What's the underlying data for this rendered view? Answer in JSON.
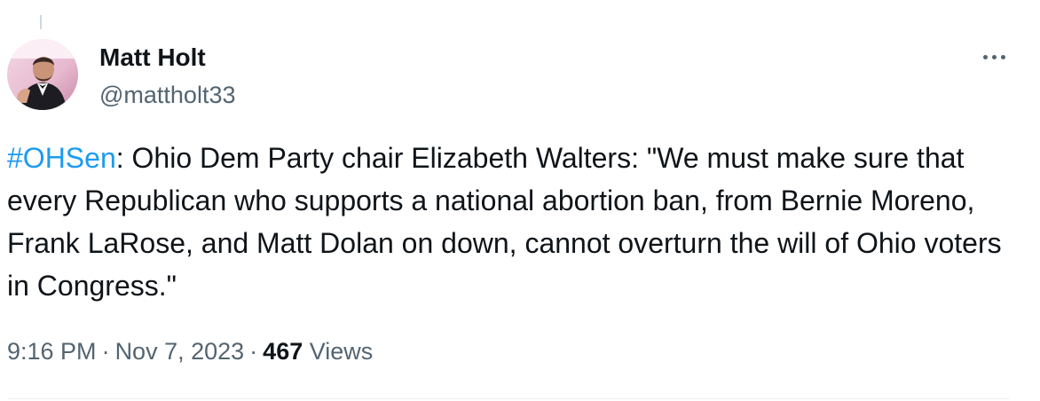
{
  "author": {
    "display_name": "Matt Holt",
    "handle": "@mattholt33"
  },
  "tweet": {
    "hashtag": "#OHSen",
    "text": ": Ohio Dem Party chair Elizabeth Walters: \"We must make sure that every Republican who supports a national abortion ban, from Bernie Moreno, Frank LaRose, and Matt Dolan on down, cannot overturn the will of Ohio voters in Congress.\""
  },
  "meta": {
    "time": "9:16 PM",
    "separator": "·",
    "date": "Nov 7, 2023",
    "views_count": "467",
    "views_label": "Views"
  },
  "colors": {
    "link": "#1d9bf0",
    "secondary_text": "#536471",
    "primary_text": "#0f1419"
  },
  "icons": {
    "more": "more-horizontal-icon"
  }
}
